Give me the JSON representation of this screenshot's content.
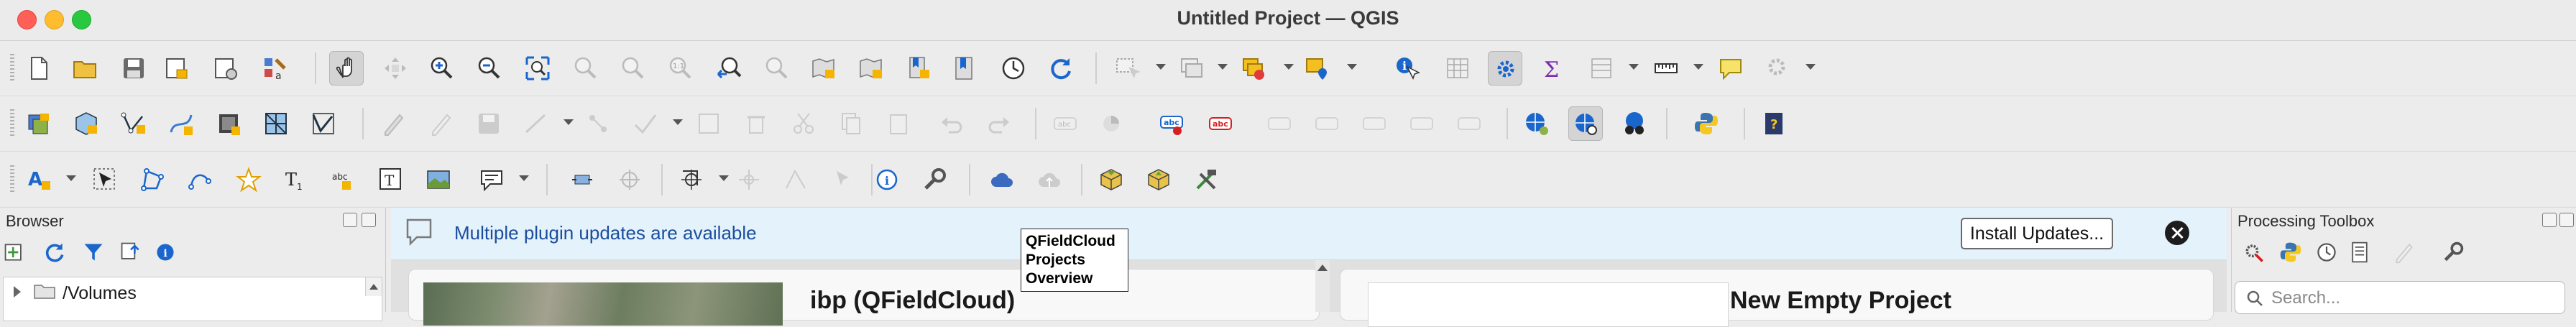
{
  "window": {
    "title": "Untitled Project — QGIS"
  },
  "message_bar": {
    "text": "Multiple plugin updates are available",
    "button_label": "Install Updates..."
  },
  "tooltip": {
    "lines": [
      "QFieldCloud",
      "Projects",
      "Overview"
    ]
  },
  "browser": {
    "title": "Browser",
    "tree_items": [
      {
        "label": "/Volumes"
      }
    ]
  },
  "welcome": {
    "recent_project_title": "ibp (QFieldCloud)",
    "template_title": "New Empty Project"
  },
  "processing": {
    "title": "Processing Toolbox",
    "search_placeholder": "Search..."
  },
  "toolbars": {
    "project": [
      "new-project",
      "open-project",
      "save-project",
      "new-print-layout",
      "layout-manager",
      "style-manager"
    ],
    "navigation": [
      "pan-map",
      "pan-to-selection",
      "zoom-in",
      "zoom-out",
      "zoom-full",
      "zoom-to-selection",
      "zoom-to-layer",
      "zoom-native",
      "zoom-last",
      "zoom-next",
      "new-map-view",
      "new-3d-view",
      "new-spatial-bookmark",
      "show-bookmarks",
      "temporal-controller",
      "refresh"
    ],
    "attributes": [
      "select-features",
      "deselect",
      "identify",
      "open-attribute-table",
      "toggle-settings",
      "statistical-summary",
      "measure",
      "map-tips",
      "actions"
    ],
    "layers": [
      "data-source-manager",
      "add-layer",
      "digitize-vertex",
      "digitize-curve",
      "add-raster",
      "add-mesh",
      "add-virtual-layer",
      "toggle-editing",
      "save-edits",
      "add-feature",
      "vertex-tool",
      "delete-selected",
      "cut",
      "copy",
      "paste",
      "undo",
      "redo",
      "labeling",
      "python-console",
      "help"
    ],
    "extra": [
      "annotation",
      "select-label",
      "add-polygon",
      "add-point-pattern",
      "add-star",
      "add-text-annotation",
      "add-linked-text",
      "add-text",
      "add-image",
      "callout",
      "pin-labels",
      "show-labels",
      "move-label",
      "rotate-label",
      "change-label",
      "about",
      "settings",
      "qfieldcloud",
      "cloud-sync",
      "package-project",
      "sync-project",
      "build-tools"
    ]
  },
  "colors": {
    "accent": "#1b4d9e",
    "message_bg": "#e4f2fb",
    "toolbar_bg": "#ececec"
  }
}
